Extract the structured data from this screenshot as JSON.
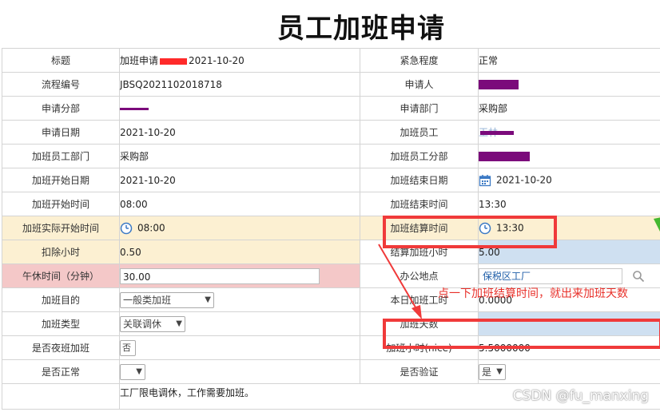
{
  "page": {
    "title": "员工加班申请"
  },
  "form": {
    "labels": {
      "title": "标题",
      "urgency": "紧急程度",
      "process_no": "流程编号",
      "applicant": "申请人",
      "apply_division": "申请分部",
      "apply_dept": "申请部门",
      "apply_date": "申请日期",
      "ot_employee": "加班员工",
      "ot_emp_dept": "加班员工部门",
      "ot_emp_division": "加班员工分部",
      "ot_start_date": "加班开始日期",
      "ot_end_date": "加班结束日期",
      "ot_start_time": "加班开始时间",
      "ot_end_time": "加班结束时间",
      "actual_start_time": "加班实际开始时间",
      "settle_time": "加班结算时间",
      "deduct_hours": "扣除小时",
      "settle_hours": "结算加班小时",
      "lunch_break": "午休时间（分钟）",
      "office_location": "办公地点",
      "purpose": "加班目的",
      "today_ot_hours": "本日加班工时",
      "ot_type": "加班类型",
      "ot_days": "加班天数",
      "night_ot": "是否夜班加班",
      "ot_hours_nice": "加班小时(nice)",
      "is_normal": "是否正常",
      "is_verified": "是否验证"
    },
    "values": {
      "title_prefix": "加班申请",
      "title_suffix": "2021-10-20",
      "urgency": "正常",
      "process_no": "JBSQ2021102018718",
      "apply_dept": "采购部",
      "apply_date": "2021-10-20",
      "ot_employee_partial": "王林",
      "ot_emp_dept": "采购部",
      "ot_start_date": "2021-10-20",
      "ot_end_date": "2021-10-20",
      "ot_start_time": "08:00",
      "ot_end_time": "13:30",
      "actual_start_time": "08:00",
      "settle_time": "13:30",
      "deduct_hours": "0.50",
      "settle_hours": "5.00",
      "lunch_break": "30.00",
      "office_location": "保税区工厂",
      "purpose": "一般类加班",
      "today_ot_hours": "0.0000",
      "ot_type": "关联调休",
      "ot_days": "",
      "night_ot": "否",
      "ot_hours_nice": "5.5000000",
      "is_normal": "",
      "is_verified": "是",
      "remark": "工厂限电调休，工作需要加班。"
    }
  },
  "annotation": {
    "text": "点一下加班结算时间，就出来加班天数"
  },
  "watermark": "CSDN @fu_manxing",
  "colors": {
    "highlight_yellow": "#fcf0d2",
    "highlight_blue": "#cfe0f1",
    "highlight_pink": "#f4c8c8",
    "annotation_red": "#f03a3a",
    "link": "#1f5ea8",
    "redaction_purple": "#7b0a7b"
  },
  "icons": {
    "clock": "clock-icon",
    "calendar": "calendar-icon",
    "search": "search-icon",
    "dropdown": "chevron-down-icon"
  }
}
